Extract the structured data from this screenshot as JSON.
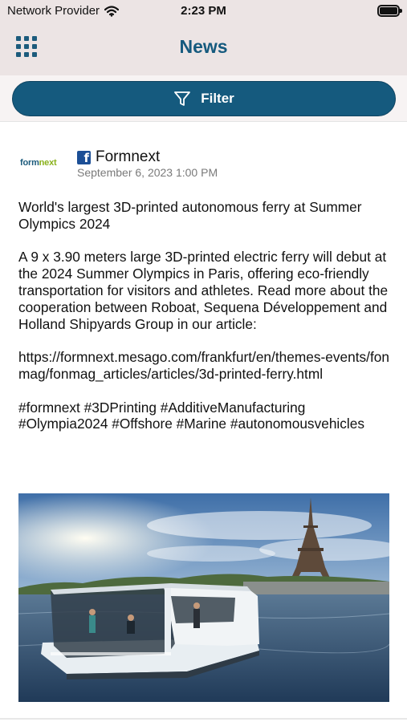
{
  "status_bar": {
    "carrier": "Network Provider",
    "time": "2:23 PM",
    "wifi_icon": "wifi-icon",
    "battery_icon": "battery-icon"
  },
  "header": {
    "title": "News",
    "menu_icon": "grid-menu-icon"
  },
  "filter": {
    "label": "Filter",
    "icon": "funnel-icon"
  },
  "post": {
    "logo_text_a": "form",
    "logo_text_b": "next",
    "source_icon": "facebook-icon",
    "source_name": "Formnext",
    "date": "September 6, 2023 1:00 PM",
    "headline": "World's largest 3D-printed autonomous ferry at Summer Olympics 2024",
    "body": "A 9 x 3.90 meters large 3D-printed electric ferry will debut at the 2024 Summer Olympics in Paris, offering eco-friendly transportation for visitors and athletes. Read more about the cooperation between Roboat, Sequena Développement and Holland Shipyards Group in our article:",
    "link": "https://formnext.mesago.com/frankfurt/en/themes-events/fonmag/fonmag_articles/articles/3d-printed-ferry.html",
    "hashtags": "#formnext #3DPrinting #AdditiveManufacturing #Olympia2024 #Offshore #Marine #autonomousvehicles",
    "image_icon": "ferry-eiffel-tower-photo"
  },
  "colors": {
    "brand": "#155a7e",
    "topbar_bg": "#ece4e4",
    "logo_green": "#8ab11c",
    "facebook": "#1c4f96"
  }
}
